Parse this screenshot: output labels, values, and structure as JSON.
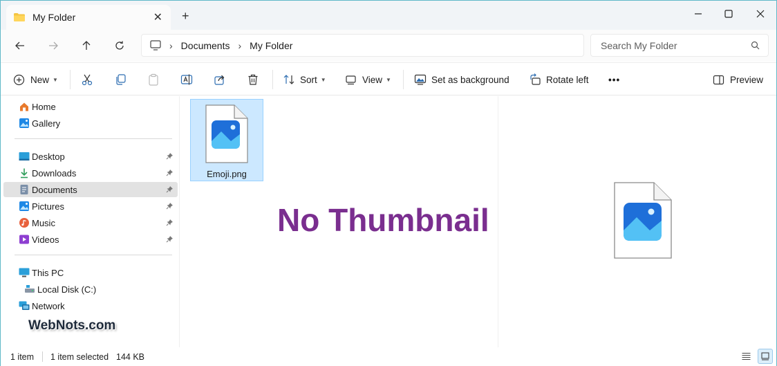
{
  "window": {
    "tab_title": "My Folder",
    "new_tab_symbol": "+",
    "tab_close_symbol": "✕",
    "minimize_symbol": "—",
    "maximize_symbol": "☐",
    "close_symbol": "✕"
  },
  "address_bar": {
    "breadcrumbs": [
      "Documents",
      "My Folder"
    ],
    "separator": "›",
    "search_placeholder": "Search My Folder"
  },
  "command_bar": {
    "new_label": "New",
    "sort_label": "Sort",
    "view_label": "View",
    "set_background_label": "Set as background",
    "rotate_left_label": "Rotate left",
    "more_label": "•••",
    "preview_label": "Preview"
  },
  "sidebar": {
    "quick": [
      {
        "label": "Home",
        "icon": "home-icon"
      },
      {
        "label": "Gallery",
        "icon": "gallery-icon"
      }
    ],
    "pinned": [
      {
        "label": "Desktop",
        "icon": "desktop-icon",
        "selected": false
      },
      {
        "label": "Downloads",
        "icon": "downloads-icon",
        "selected": false
      },
      {
        "label": "Documents",
        "icon": "documents-icon",
        "selected": true
      },
      {
        "label": "Pictures",
        "icon": "pictures-icon",
        "selected": false
      },
      {
        "label": "Music",
        "icon": "music-icon",
        "selected": false
      },
      {
        "label": "Videos",
        "icon": "videos-icon",
        "selected": false
      }
    ],
    "devices": [
      {
        "label": "This PC",
        "icon": "this-pc-icon"
      },
      {
        "label": "Local Disk (C:)",
        "icon": "local-disk-icon"
      },
      {
        "label": "Network",
        "icon": "network-icon"
      }
    ]
  },
  "content": {
    "files": [
      {
        "name": "Emoji.png",
        "icon": "image-file-icon",
        "selected": true
      }
    ],
    "overlay_text": "No Thumbnail"
  },
  "watermark": "WebNots.com",
  "status_bar": {
    "item_count": "1 item",
    "selected_text": "1 item selected",
    "size_text": "144 KB"
  },
  "colors": {
    "accent": "#0067c0",
    "selection_fill": "#cce8ff",
    "overlay_text": "#7a2e8f",
    "titlebar_bg": "#f1f4f7"
  }
}
